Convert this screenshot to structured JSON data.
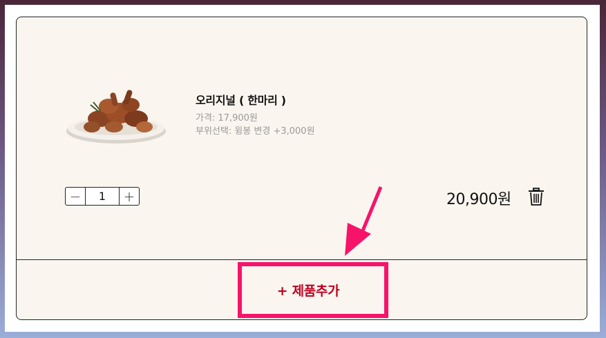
{
  "product": {
    "name": "오리지널 ( 한마리 )",
    "price_line": "가격: 17,900원",
    "option_line": "부위선택: 윙봉 변경 +3,000원",
    "image_icon": "fried-chicken-plate"
  },
  "quantity": {
    "minus": "−",
    "value": "1",
    "plus": "+"
  },
  "total": "20,900원",
  "add_product": "+ 제품추가",
  "colors": {
    "highlight": "#f7136a",
    "add_text": "#c0001e",
    "card_bg": "#faf5ef"
  }
}
